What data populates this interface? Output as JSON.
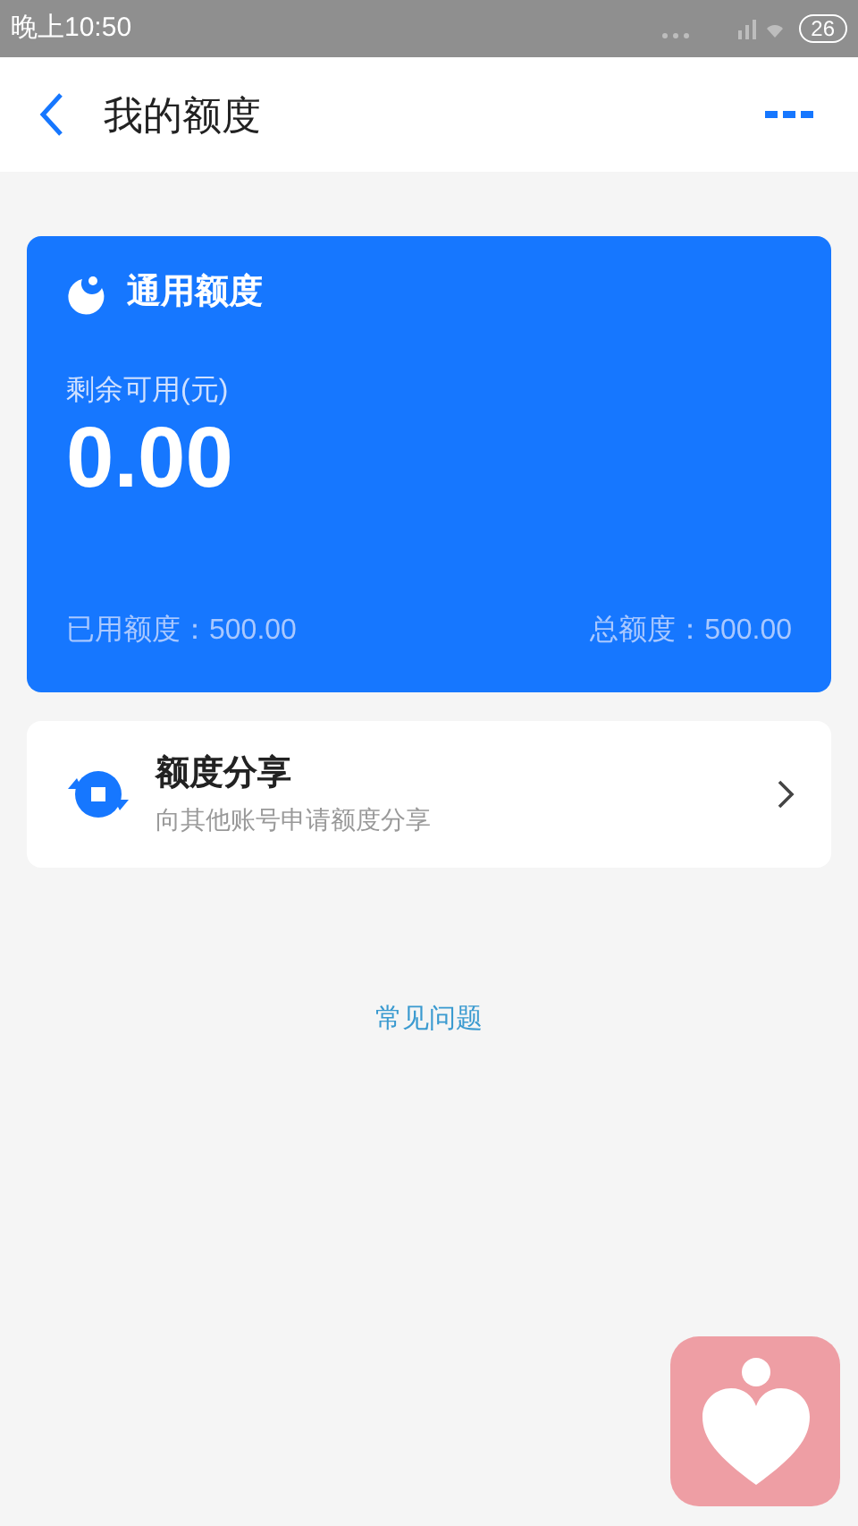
{
  "status_bar": {
    "time": "晚上10:50",
    "battery": "26"
  },
  "header": {
    "title": "我的额度"
  },
  "quota_card": {
    "title": "通用额度",
    "available_label": "剩余可用(元)",
    "available_amount": "0.00",
    "used": "已用额度：500.00",
    "total": "总额度：500.00"
  },
  "share_item": {
    "title": "额度分享",
    "subtitle": "向其他账号申请额度分享"
  },
  "faq_link": "常见问题"
}
